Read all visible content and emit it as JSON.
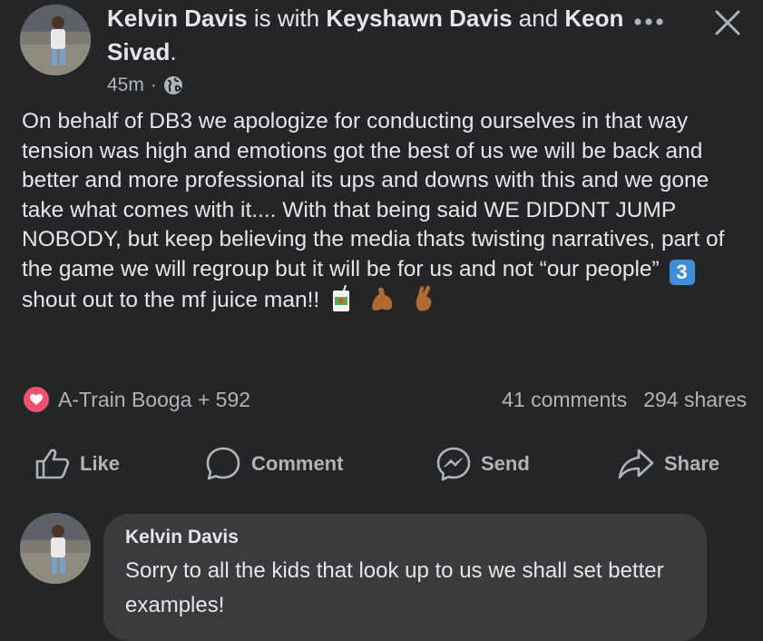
{
  "post": {
    "author": "Kelvin Davis",
    "with_text": " is with ",
    "tagged_1": "Keyshawn Davis",
    "and_text": " and ",
    "tagged_2": "Keon Sivad",
    "period": ".",
    "time": "45m",
    "dot": "·",
    "privacy_icon": "globe-icon",
    "body_part1": "On behalf of DB3 we apologize for conducting ourselves in that way tension was high and emotions got the best of us we will be back and better and more professional its ups and downs with this and we gone take what comes with it.... With that being said WE DIDDNT JUMP NOBODY, but keep believing the media thats twisting narratives, part of the game we will regroup but it will be for us and not  “our people”",
    "keycap_emoji": "3",
    "body_part2": "shout out to the mf juice man!!"
  },
  "reactions": {
    "icon": "love-reaction-icon",
    "text": "A-Train Booga + 592",
    "comments": "41 comments",
    "shares": "294 shares"
  },
  "actions": {
    "like": "Like",
    "comment": "Comment",
    "send": "Send",
    "share": "Share"
  },
  "comment": {
    "author": "Kelvin Davis",
    "text": "Sorry to all the kids that look up to us we shall set better examples!"
  },
  "colors": {
    "background": "#242526",
    "text": "#e4e6eb",
    "secondary": "#b0b3b8",
    "bubble": "#3a3b3c",
    "love": "#f0506e",
    "keycap": "#3b8fd9"
  }
}
